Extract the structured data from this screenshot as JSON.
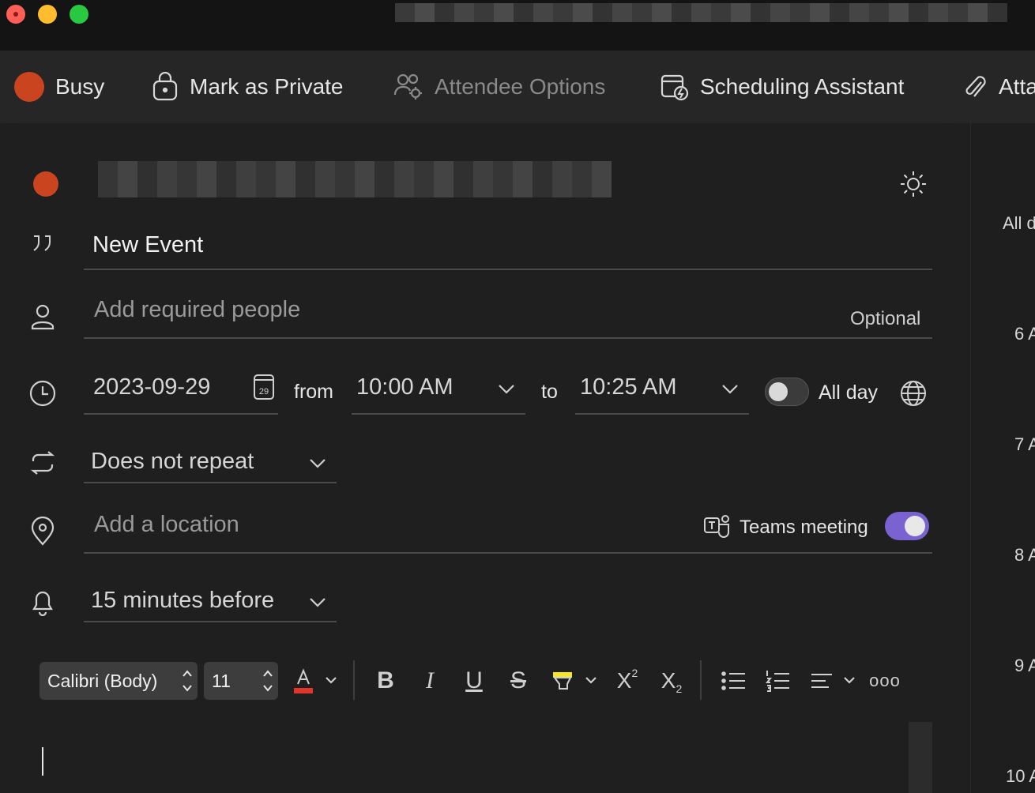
{
  "window": {
    "title": ""
  },
  "toolbar": {
    "busy_label": "Busy",
    "private_label": "Mark as Private",
    "attendee_options_label": "Attendee Options",
    "scheduling_label": "Scheduling Assistant",
    "attach_label": "Atta"
  },
  "event": {
    "title_value": "New Event",
    "people_placeholder": "Add required people",
    "optional_label": "Optional",
    "date_value": "2023-09-29",
    "calendar_badge_day": "29",
    "from_label": "from",
    "start_time": "10:00 AM",
    "to_label": "to",
    "end_time": "10:25 AM",
    "all_day_label": "All day",
    "all_day_on": false,
    "repeat_value": "Does not repeat",
    "location_placeholder": "Add a location",
    "teams_label": "Teams meeting",
    "teams_on": true,
    "reminder_value": "15 minutes before"
  },
  "formatting": {
    "font_name": "Calibri (Body)",
    "font_size": "11",
    "bold": "B",
    "italic": "I",
    "underline": "U",
    "strike": "S",
    "superscript": "X",
    "superscript_mark": "2",
    "subscript": "X",
    "subscript_mark": "2",
    "more": "ooo"
  },
  "calendar_sidebar": {
    "all_day_label": "All d",
    "hours": [
      "6 A",
      "7 A",
      "8 A",
      "9 A",
      "10 A"
    ]
  },
  "colors": {
    "accent_purple": "#7a63d1",
    "busy_orange": "#c9441f",
    "font_color_red": "#e0352b",
    "highlight_yellow": "#f5e62a"
  }
}
